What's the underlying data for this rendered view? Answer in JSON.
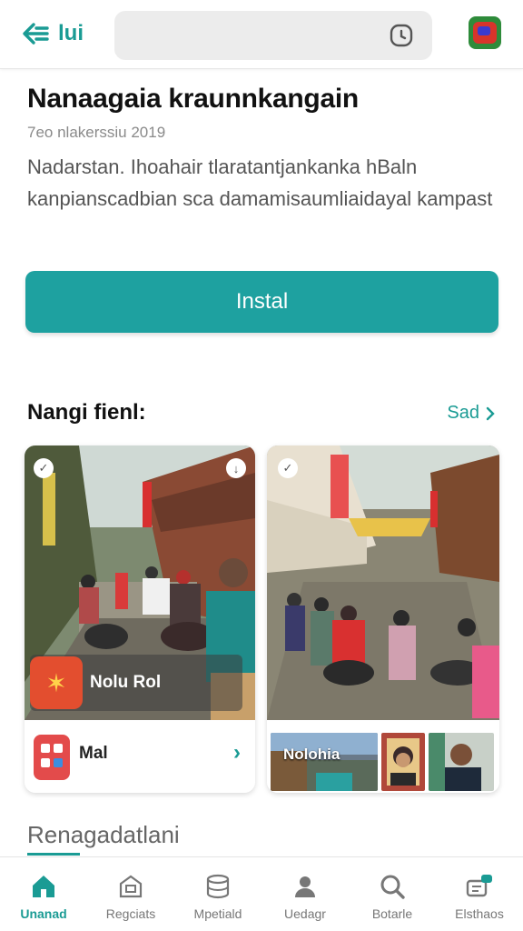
{
  "header": {
    "back_label": "lui"
  },
  "app": {
    "title": "Nanaagaia kraunnkangain",
    "subtitle": "7eo nlakerssiu 2019",
    "description": "Nadarstan. Ihoahair tlaratantjankanka hBaln kanpianscadbian sca damamisaumliaidayal kampast",
    "install_label": "Instal"
  },
  "section": {
    "title": "Nangi fienl:",
    "see_all": "Sad"
  },
  "cards": [
    {
      "overlay_label": "Nolu Rol",
      "footer_label": "Mal",
      "check_left": "✓",
      "check_right": "↓"
    },
    {
      "thumb_label": "Nolohia",
      "check_left": "✓"
    }
  ],
  "section2": {
    "title": "Renagadatlani"
  },
  "nav": [
    {
      "label": "Unanad",
      "icon": "home-icon",
      "active": true
    },
    {
      "label": "Regciats",
      "icon": "store-icon"
    },
    {
      "label": "Mpetiald",
      "icon": "database-icon"
    },
    {
      "label": "Uedagr",
      "icon": "user-icon"
    },
    {
      "label": "Botarle",
      "icon": "search-icon"
    },
    {
      "label": "Elsthaos",
      "icon": "inbox-icon"
    }
  ],
  "colors": {
    "accent": "#1a9b94",
    "install": "#1ea1a0"
  }
}
